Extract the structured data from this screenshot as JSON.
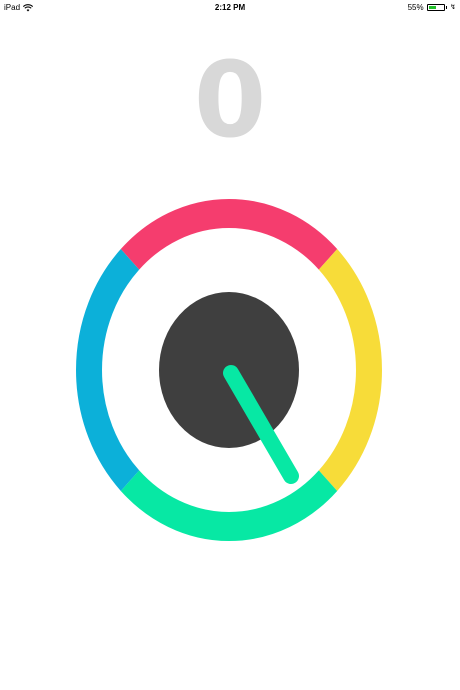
{
  "status_bar": {
    "device": "iPad",
    "time": "2:12 PM",
    "battery_percent": "55%",
    "battery_level": 0.55,
    "wifi_icon": "wifi-icon",
    "battery_icon": "battery-icon"
  },
  "game": {
    "score": "0",
    "ring_colors": {
      "top": "#f53d6e",
      "right": "#f7dc39",
      "bottom": "#07e8a4",
      "left": "#0cb0d9"
    },
    "center_color": "#3f3f3f",
    "pointer_color": "#07e8a4",
    "background": "#ffffff"
  }
}
